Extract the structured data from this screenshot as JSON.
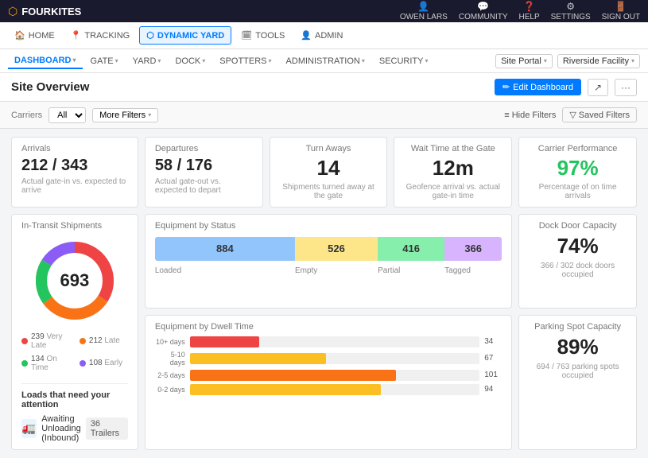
{
  "topbar": {
    "logo": "FOURKITES",
    "nav_items": [
      {
        "label": "OWEN LARS",
        "icon": "👤"
      },
      {
        "label": "COMMUNITY",
        "icon": "💬"
      },
      {
        "label": "HELP",
        "icon": "❓"
      },
      {
        "label": "SETTINGS",
        "icon": "⚙"
      },
      {
        "label": "SIGN OUT",
        "icon": "🚪"
      }
    ]
  },
  "main_nav": {
    "items": [
      {
        "label": "HOME",
        "icon": "🏠",
        "active": false
      },
      {
        "label": "TRACKING",
        "icon": "📍",
        "active": false
      },
      {
        "label": "DYNAMIC YARD",
        "icon": "⬡",
        "active": true
      },
      {
        "label": "TOOLS",
        "icon": "🗓",
        "active": false
      },
      {
        "label": "ADMIN",
        "icon": "👤",
        "active": false
      }
    ]
  },
  "sub_nav": {
    "items": [
      {
        "label": "DASHBOARD",
        "active": true
      },
      {
        "label": "GATE",
        "active": false
      },
      {
        "label": "YARD",
        "active": false
      },
      {
        "label": "DOCK",
        "active": false
      },
      {
        "label": "SPOTTERS",
        "active": false
      },
      {
        "label": "ADMINISTRATION",
        "active": false
      },
      {
        "label": "SECURITY",
        "active": false
      }
    ],
    "site_portal": "Site Portal",
    "facility": "Riverside Facility"
  },
  "page_header": {
    "title": "Site Overview",
    "edit_button": "Edit Dashboard",
    "share_icon": "share",
    "more_icon": "more"
  },
  "filters": {
    "carrier_label": "Carriers",
    "carrier_value": "All",
    "more_filters": "More Filters",
    "hide_filters": "Hide Filters",
    "saved_filters": "Saved Filters"
  },
  "stats": {
    "arrivals": {
      "title": "Arrivals",
      "value": "212 / 343",
      "sub": "Actual gate-in vs. expected to arrive"
    },
    "departures": {
      "title": "Departures",
      "value": "58 / 176",
      "sub": "Actual gate-out vs. expected to depart"
    },
    "turn_aways": {
      "title": "Turn Aways",
      "value": "14",
      "sub": "Shipments turned away at the gate"
    },
    "wait_time": {
      "title": "Wait Time at the Gate",
      "value": "12m",
      "sub": "Geofence arrival vs. actual gate-in time"
    },
    "carrier_perf": {
      "title": "Carrier Performance",
      "value": "97%",
      "sub": "Percentage of on time arrivals"
    }
  },
  "transit": {
    "title": "In-Transit Shipments",
    "total": "693",
    "segments": [
      {
        "label": "Very Late",
        "value": 239,
        "color": "#ef4444",
        "pct": 34
      },
      {
        "label": "Late",
        "value": 212,
        "color": "#f97316",
        "pct": 31
      },
      {
        "label": "On Time",
        "value": 134,
        "color": "#22c55e",
        "pct": 19
      },
      {
        "label": "Early",
        "value": 108,
        "color": "#8b5cf6",
        "pct": 16
      }
    ]
  },
  "equipment_status": {
    "title": "Equipment by Status",
    "segments": [
      {
        "label": "Loaded",
        "value": 884,
        "color": "#93c5fd",
        "pct": 44
      },
      {
        "label": "Empty",
        "value": 526,
        "color": "#fde68a",
        "pct": 26
      },
      {
        "label": "Partial",
        "value": 416,
        "color": "#86efac",
        "pct": 21
      },
      {
        "label": "Tagged",
        "value": 366,
        "color": "#d8b4fe",
        "pct": 18
      }
    ]
  },
  "dwell_time": {
    "title": "Equipment by Dwell Time",
    "bars": [
      {
        "label": "10+ days",
        "value": 34,
        "pct": 24,
        "color": "#ef4444"
      },
      {
        "label": "5-10 days",
        "value": 67,
        "pct": 47,
        "color": "#fbbf24"
      },
      {
        "label": "2-5 days",
        "value": 101,
        "pct": 71,
        "color": "#f97316"
      },
      {
        "label": "0-2 days",
        "value": 94,
        "pct": 66,
        "color": "#fbbf24"
      }
    ]
  },
  "dock_capacity": {
    "title": "Dock Door Capacity",
    "value": "74%",
    "sub": "366 / 302 dock doors occupied"
  },
  "parking_capacity": {
    "title": "Parking Spot Capacity",
    "value": "89%",
    "sub": "694 / 763 parking spots occupied"
  },
  "attention": {
    "title": "Loads that need your attention",
    "items": [
      {
        "label": "Awaiting Unloading (Inbound)",
        "count": "36 Trailers"
      }
    ]
  }
}
